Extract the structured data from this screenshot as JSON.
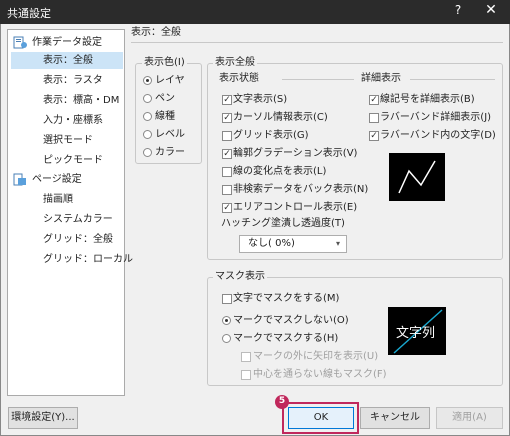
{
  "window": {
    "title": "共通設定",
    "help": "?",
    "close": "✕"
  },
  "tree": {
    "items": [
      {
        "label": "作業データ設定",
        "icon": "folder-doc-icon"
      },
      {
        "label": "表示：全般",
        "selected": true
      },
      {
        "label": "表示：ラスタ"
      },
      {
        "label": "表示：標高・DM"
      },
      {
        "label": "入力・座標系"
      },
      {
        "label": "選択モード"
      },
      {
        "label": "ピックモード"
      },
      {
        "label": "ページ設定",
        "icon": "page-icon"
      },
      {
        "label": "描画順"
      },
      {
        "label": "システムカラー"
      },
      {
        "label": "グリッド：全般"
      },
      {
        "label": "グリッド：ローカル"
      }
    ]
  },
  "pane": {
    "title": "表示：全般"
  },
  "color_group": {
    "legend": "表示色(I)",
    "options": [
      {
        "label": "レイヤ",
        "checked": true
      },
      {
        "label": "ペン"
      },
      {
        "label": "線種"
      },
      {
        "label": "レベル"
      },
      {
        "label": "カラー"
      }
    ]
  },
  "general": {
    "legend": "表示全般",
    "state_heading": "表示状態",
    "detail_heading": "詳細表示",
    "state_items": [
      {
        "label": "文字表示(S)",
        "checked": true
      },
      {
        "label": "カーソル情報表示(C)",
        "checked": true
      },
      {
        "label": "グリッド表示(G)",
        "checked": false
      },
      {
        "label": "輪郭グラデーション表示(V)",
        "checked": true
      },
      {
        "label": "線の変化点を表示(L)",
        "checked": false
      },
      {
        "label": "非検索データをバック表示(N)",
        "checked": false
      },
      {
        "label": "エリアコントロール表示(E)",
        "checked": true
      }
    ],
    "detail_items": [
      {
        "label": "線記号を詳細表示(B)",
        "checked": true
      },
      {
        "label": "ラバーバンド詳細表示(J)",
        "checked": false
      },
      {
        "label": "ラバーバンド内の文字(D)",
        "checked": true
      }
    ],
    "hatch_label": "ハッチング塗潰し透過度(T)",
    "hatch_value": "なし( 0%)",
    "dropdown_arrow": "▾"
  },
  "mask": {
    "legend": "マスク表示",
    "text_mask": {
      "label": "文字でマスクをする(M)",
      "checked": false
    },
    "radio": [
      {
        "label": "マークでマスクしない(O)",
        "checked": true
      },
      {
        "label": "マークでマスクする(H)",
        "checked": false
      }
    ],
    "sub": [
      {
        "label": "マークの外に矢印を表示(U)"
      },
      {
        "label": "中心を通らない線もマスク(F)"
      }
    ],
    "preview_text": "文字列"
  },
  "buttons": {
    "env": "環境設定(Y)...",
    "ok": "OK",
    "cancel": "キャンセル",
    "apply": "適用(A)"
  },
  "step_badge": "5",
  "check_mark": "✓"
}
